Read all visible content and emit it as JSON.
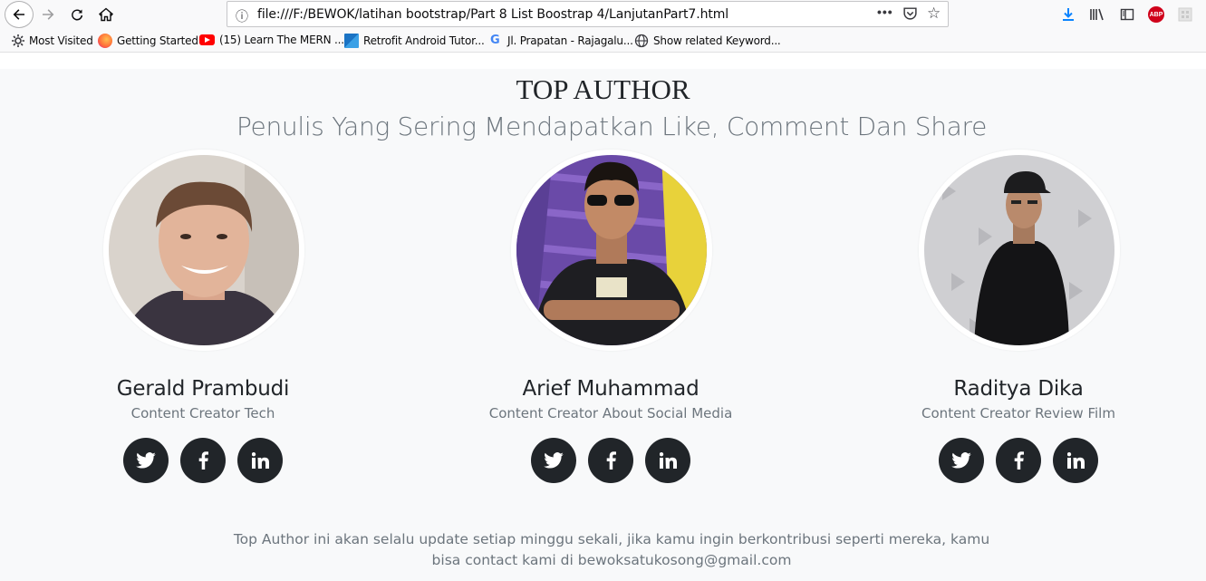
{
  "browser": {
    "url": "file:///F:/BEWOK/latihan bootstrap/Part 8 List Boostrap 4/LanjutanPart7.html",
    "bookmarks": [
      {
        "label": "Most Visited",
        "icon": "gear-icon"
      },
      {
        "label": "Getting Started",
        "icon": "firefox-icon"
      },
      {
        "label": "(15) Learn The MERN ...",
        "icon": "youtube-icon"
      },
      {
        "label": "Retrofit Android Tutor...",
        "icon": "retrofit-icon"
      },
      {
        "label": "Jl. Prapatan - Rajagalu...",
        "icon": "google-icon"
      },
      {
        "label": "Show related Keyword...",
        "icon": "globe-icon"
      }
    ],
    "adblock_label": "ABP"
  },
  "page": {
    "title": "TOP AUTHOR",
    "subtitle": "Penulis Yang Sering Mendapatkan Like, Comment Dan Share",
    "authors": [
      {
        "name": "Gerald Prambudi",
        "role": "Content Creator Tech",
        "photo": "young man with brown hair, dark hoodie"
      },
      {
        "name": "Arief Muhammad",
        "role": "Content Creator About Social Media",
        "photo": "man in sunglasses, black t-shirt, purple graffiti wall"
      },
      {
        "name": "Raditya Dika",
        "role": "Content Creator Review Film",
        "photo": "man in cap, black shirt, grey wall"
      }
    ],
    "socials": [
      "twitter-icon",
      "facebook-icon",
      "linkedin-icon"
    ],
    "footer": "Top Author ini akan selalu update setiap minggu sekali, jika kamu ingin berkontribusi seperti mereka, kamu bisa contact kami di bewoksatukosong@gmail.com"
  },
  "colors": {
    "page_bg": "#f8f9fa",
    "dark_btn": "#212529",
    "muted_text": "#6c757d"
  }
}
